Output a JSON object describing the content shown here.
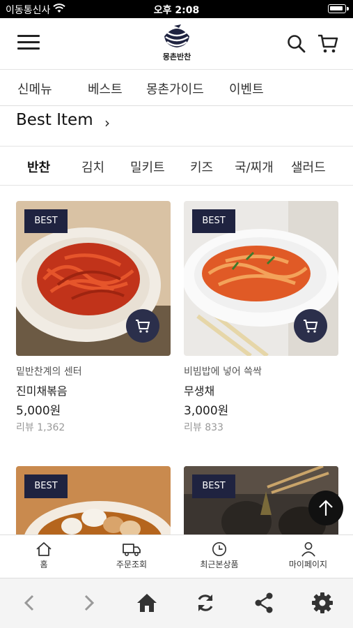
{
  "status": {
    "carrier": "이동통신사",
    "time": "오후 2:08"
  },
  "header": {
    "logo_text": "몽촌반찬"
  },
  "nav": {
    "items": [
      "신메뉴",
      "베스트",
      "몽촌가이드",
      "이벤트"
    ]
  },
  "section": {
    "title": "Best Item"
  },
  "categories": {
    "items": [
      "반찬",
      "김치",
      "밀키트",
      "키즈",
      "국/찌개",
      "샐러드"
    ],
    "active": "반찬"
  },
  "products": [
    {
      "badge": "BEST",
      "subtitle": "밑반찬계의 센터",
      "name": "진미채볶음",
      "price": "5,000원",
      "review": "리뷰 1,362"
    },
    {
      "badge": "BEST",
      "subtitle": "비빔밥에 넣어 쓱싹",
      "name": "무생채",
      "price": "3,000원",
      "review": "리뷰 833"
    },
    {
      "badge": "BEST"
    },
    {
      "badge": "BEST"
    }
  ],
  "tabbar": {
    "items": [
      "홈",
      "주문조회",
      "최근본상품",
      "마이페이지"
    ]
  },
  "colors": {
    "badge": "#1f2340",
    "cart_fab": "#2b2f4b",
    "text": "#222222"
  }
}
